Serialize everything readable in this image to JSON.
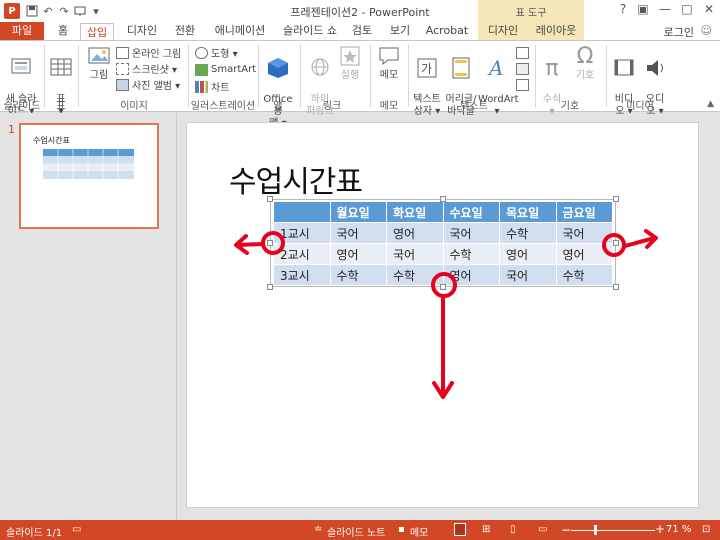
{
  "title_bar": {
    "app_logo": "P",
    "quick_access": [
      "save-icon",
      "undo-icon",
      "redo-icon",
      "slideshow-icon",
      "customize-icon"
    ],
    "title": "프레젠테이션2 - PowerPoint",
    "context_tab_header": "표 도구",
    "window_buttons": {
      "help": "?",
      "restore": "▣",
      "minimize": "—",
      "maximize": "□",
      "close": "✕"
    }
  },
  "tabs": [
    {
      "label": "파일"
    },
    {
      "label": "홈"
    },
    {
      "label": "삽입",
      "active": true
    },
    {
      "label": "디자인"
    },
    {
      "label": "전환"
    },
    {
      "label": "애니메이션"
    },
    {
      "label": "슬라이드 쇼"
    },
    {
      "label": "검토"
    },
    {
      "label": "보기"
    },
    {
      "label": "Acrobat"
    },
    {
      "label": "디자인"
    },
    {
      "label": "레이아웃"
    }
  ],
  "user": {
    "login": "로그인",
    "smiley": "☺"
  },
  "ribbon": {
    "slides": {
      "new_slide": "새 슬라\n이드 ▾",
      "group": "슬라이드"
    },
    "tables": {
      "table": "표\n▾",
      "group": "표"
    },
    "images": {
      "picture": "그림",
      "online": "온라인 그림",
      "screenshot": "스크린샷 ▾",
      "album": "사진 앨범 ▾",
      "group": "이미지"
    },
    "illustrations": {
      "shapes": "도형 ▾",
      "smartart": "SmartArt",
      "chart": "차트",
      "group": "일러스트레이션"
    },
    "apps": {
      "office": "Office용\n앱 ▾",
      "group": "앱"
    },
    "links": {
      "hyperlink": "하이\n퍼링크",
      "action": "실행",
      "group": "링크"
    },
    "comments": {
      "memo": "메모",
      "group": "메모"
    },
    "text": {
      "textbox": "텍스트\n상자 ▾",
      "header": "머리글/\n바닥글",
      "wordart": "WordArt\n▾",
      "group": "텍스트"
    },
    "symbols": {
      "equation": "수식\n▾",
      "symbol": "기호",
      "group": "기호"
    },
    "media": {
      "video": "비디\n오 ▾",
      "audio": "오디\n오 ▾",
      "group": "미디어"
    }
  },
  "thumb": {
    "number": "1",
    "title": "수업시간표"
  },
  "slide": {
    "title": "수업시간표",
    "table": {
      "headers": [
        "",
        "월요일",
        "화요일",
        "수요일",
        "목요일",
        "금요일"
      ],
      "rows": [
        [
          "1교시",
          "국어",
          "영어",
          "국어",
          "수학",
          "국어"
        ],
        [
          "2교시",
          "영어",
          "국어",
          "수학",
          "영어",
          "영어"
        ],
        [
          "3교시",
          "수학",
          "수학",
          "영어",
          "국어",
          "수학"
        ]
      ]
    }
  },
  "status": {
    "slide_count": "슬라이드 1/1",
    "notes": "슬라이드 노트",
    "comments": "메모",
    "zoom_minus": "−",
    "zoom_plus": "+",
    "zoom": "71 %"
  },
  "colors": {
    "accent": "#d24726",
    "table_header": "#5b9bd5",
    "table_band_dark": "#d1deef",
    "table_band_light": "#e9eef7",
    "annotation": "#e8001c"
  }
}
